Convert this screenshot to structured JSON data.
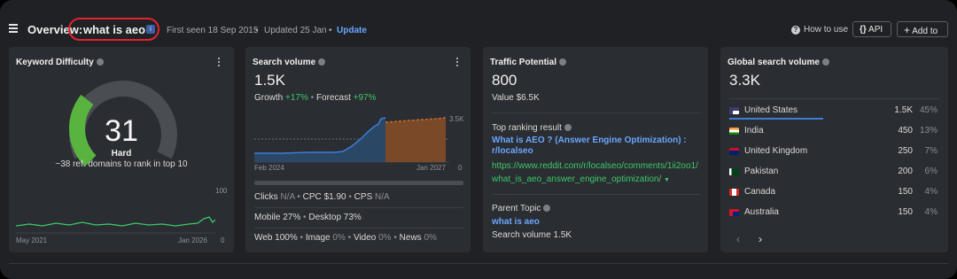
{
  "header": {
    "title_prefix": "Overview:",
    "keyword": "what is aeo",
    "info_badge": "i",
    "first_seen": "First seen 18 Sep 2015",
    "updated": "Updated 25 Jan",
    "update_link": "Update",
    "how_to_use": "How to use",
    "api_button": "API",
    "add_button": "Add to"
  },
  "kd": {
    "title": "Keyword Difficulty",
    "score": "31",
    "score_value": 31,
    "label": "Hard",
    "subtext": "~38 ref. domains to rank in top 10",
    "axis_max": "100",
    "axis_min": "0",
    "x_start": "May 2021",
    "x_end": "Jan 2026"
  },
  "sv": {
    "title": "Search volume",
    "value": "1.5K",
    "growth_label": "Growth",
    "growth_value": "+17%",
    "forecast_label": "Forecast",
    "forecast_value": "+97%",
    "axis_max": "3.5K",
    "axis_min": "0",
    "x_start": "Feb 2024",
    "x_end": "Jan 2027",
    "clicks_label": "Clicks",
    "clicks_value": "N/A",
    "cpc_label": "CPC",
    "cpc_value": "$1.90",
    "cps_label": "CPS",
    "cps_value": "N/A",
    "mobile": "Mobile 27%",
    "desktop": "Desktop 73%",
    "web_label": "Web",
    "web_value": "100%",
    "image_label": "Image",
    "image_value": "0%",
    "video_label": "Video",
    "video_value": "0%",
    "news_label": "News",
    "news_value": "0%"
  },
  "tp": {
    "title": "Traffic Potential",
    "value": "800",
    "value_line": "Value $6.5K",
    "top_result_label": "Top ranking result",
    "top_result_title": "What is AEO ? (Answer Engine Optimization) : r/localseo",
    "top_result_url": "https://www.reddit.com/r/localseo/comments/1ii2oo1/what_is_aeo_answer_engine_optimization/",
    "parent_label": "Parent Topic",
    "parent_value": "what is aeo",
    "parent_sv": "Search volume 1.5K"
  },
  "gsv": {
    "title": "Global search volume",
    "value": "3.3K",
    "countries": [
      {
        "name": "United States",
        "volume": "1.5K",
        "pct": "45%",
        "share": 45
      },
      {
        "name": "India",
        "volume": "450",
        "pct": "13%",
        "share": 13
      },
      {
        "name": "United Kingdom",
        "volume": "250",
        "pct": "7%",
        "share": 7
      },
      {
        "name": "Pakistan",
        "volume": "200",
        "pct": "6%",
        "share": 6
      },
      {
        "name": "Canada",
        "volume": "150",
        "pct": "4%",
        "share": 4
      },
      {
        "name": "Australia",
        "volume": "150",
        "pct": "4%",
        "share": 4
      }
    ]
  },
  "colors": {
    "accent_blue": "#3c7fd8",
    "green": "#3ec96a",
    "forecast_orange": "#c56a2c",
    "highlight_red": "#e3232f"
  }
}
